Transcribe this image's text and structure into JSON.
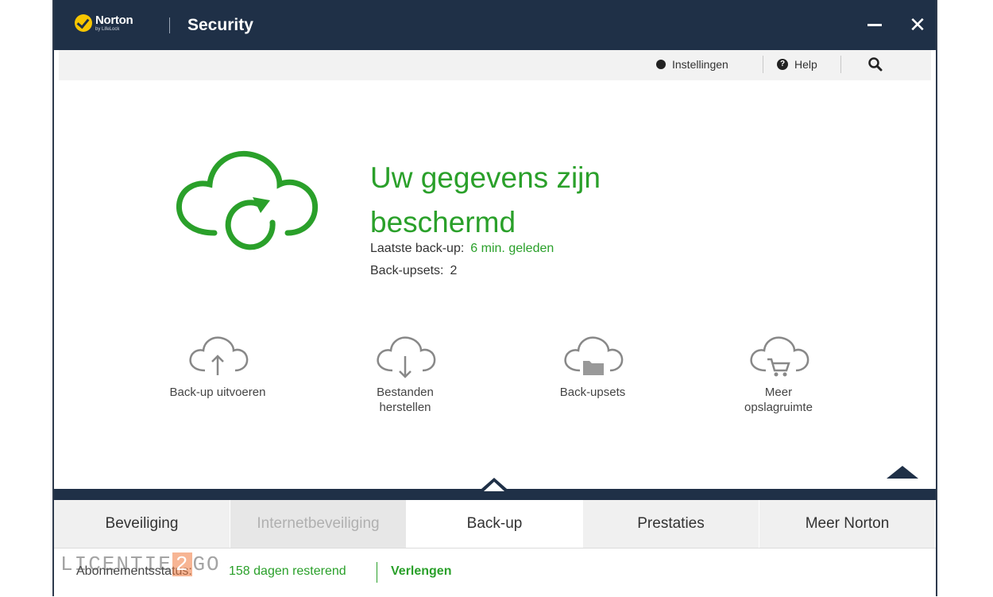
{
  "app": {
    "brand": "Norton",
    "brand_sub": "by LifeLock",
    "title": "Security",
    "minimize": "—",
    "close": "✕"
  },
  "toolbar": {
    "settings": "Instellingen",
    "help": "Help"
  },
  "main": {
    "title_line1": "Uw gegevens zijn",
    "title_line2": "beschermd",
    "last_backup_label": "Laatste back-up:",
    "last_backup_value": "6 min. geleden",
    "backup_sets_label": "Back-upsets:",
    "backup_sets_value": "2"
  },
  "actions": [
    {
      "label": "Back-up uitvoeren",
      "icon": "cloud-upload-icon"
    },
    {
      "label_1": "Bestanden",
      "label_2": "herstellen",
      "icon": "cloud-download-icon"
    },
    {
      "label": "Back-upsets",
      "icon": "cloud-folder-icon"
    },
    {
      "label_1": "Meer",
      "label_2": "opslagruimte",
      "icon": "cloud-cart-icon"
    }
  ],
  "tabs": [
    {
      "label": "Beveiliging"
    },
    {
      "label": "Internetbeveiliging"
    },
    {
      "label": "Back-up"
    },
    {
      "label": "Prestaties"
    },
    {
      "label": "Meer Norton"
    }
  ],
  "status": {
    "label": "Abonnementsstatus:",
    "days": "158 dagen resterend",
    "renew": "Verlengen"
  },
  "watermark": {
    "left": "LICENTIE",
    "num": "2",
    "right": "GO"
  },
  "colors": {
    "accent_green": "#2aa02a",
    "titlebar": "#1f3047",
    "brand_yellow": "#f7c600"
  }
}
